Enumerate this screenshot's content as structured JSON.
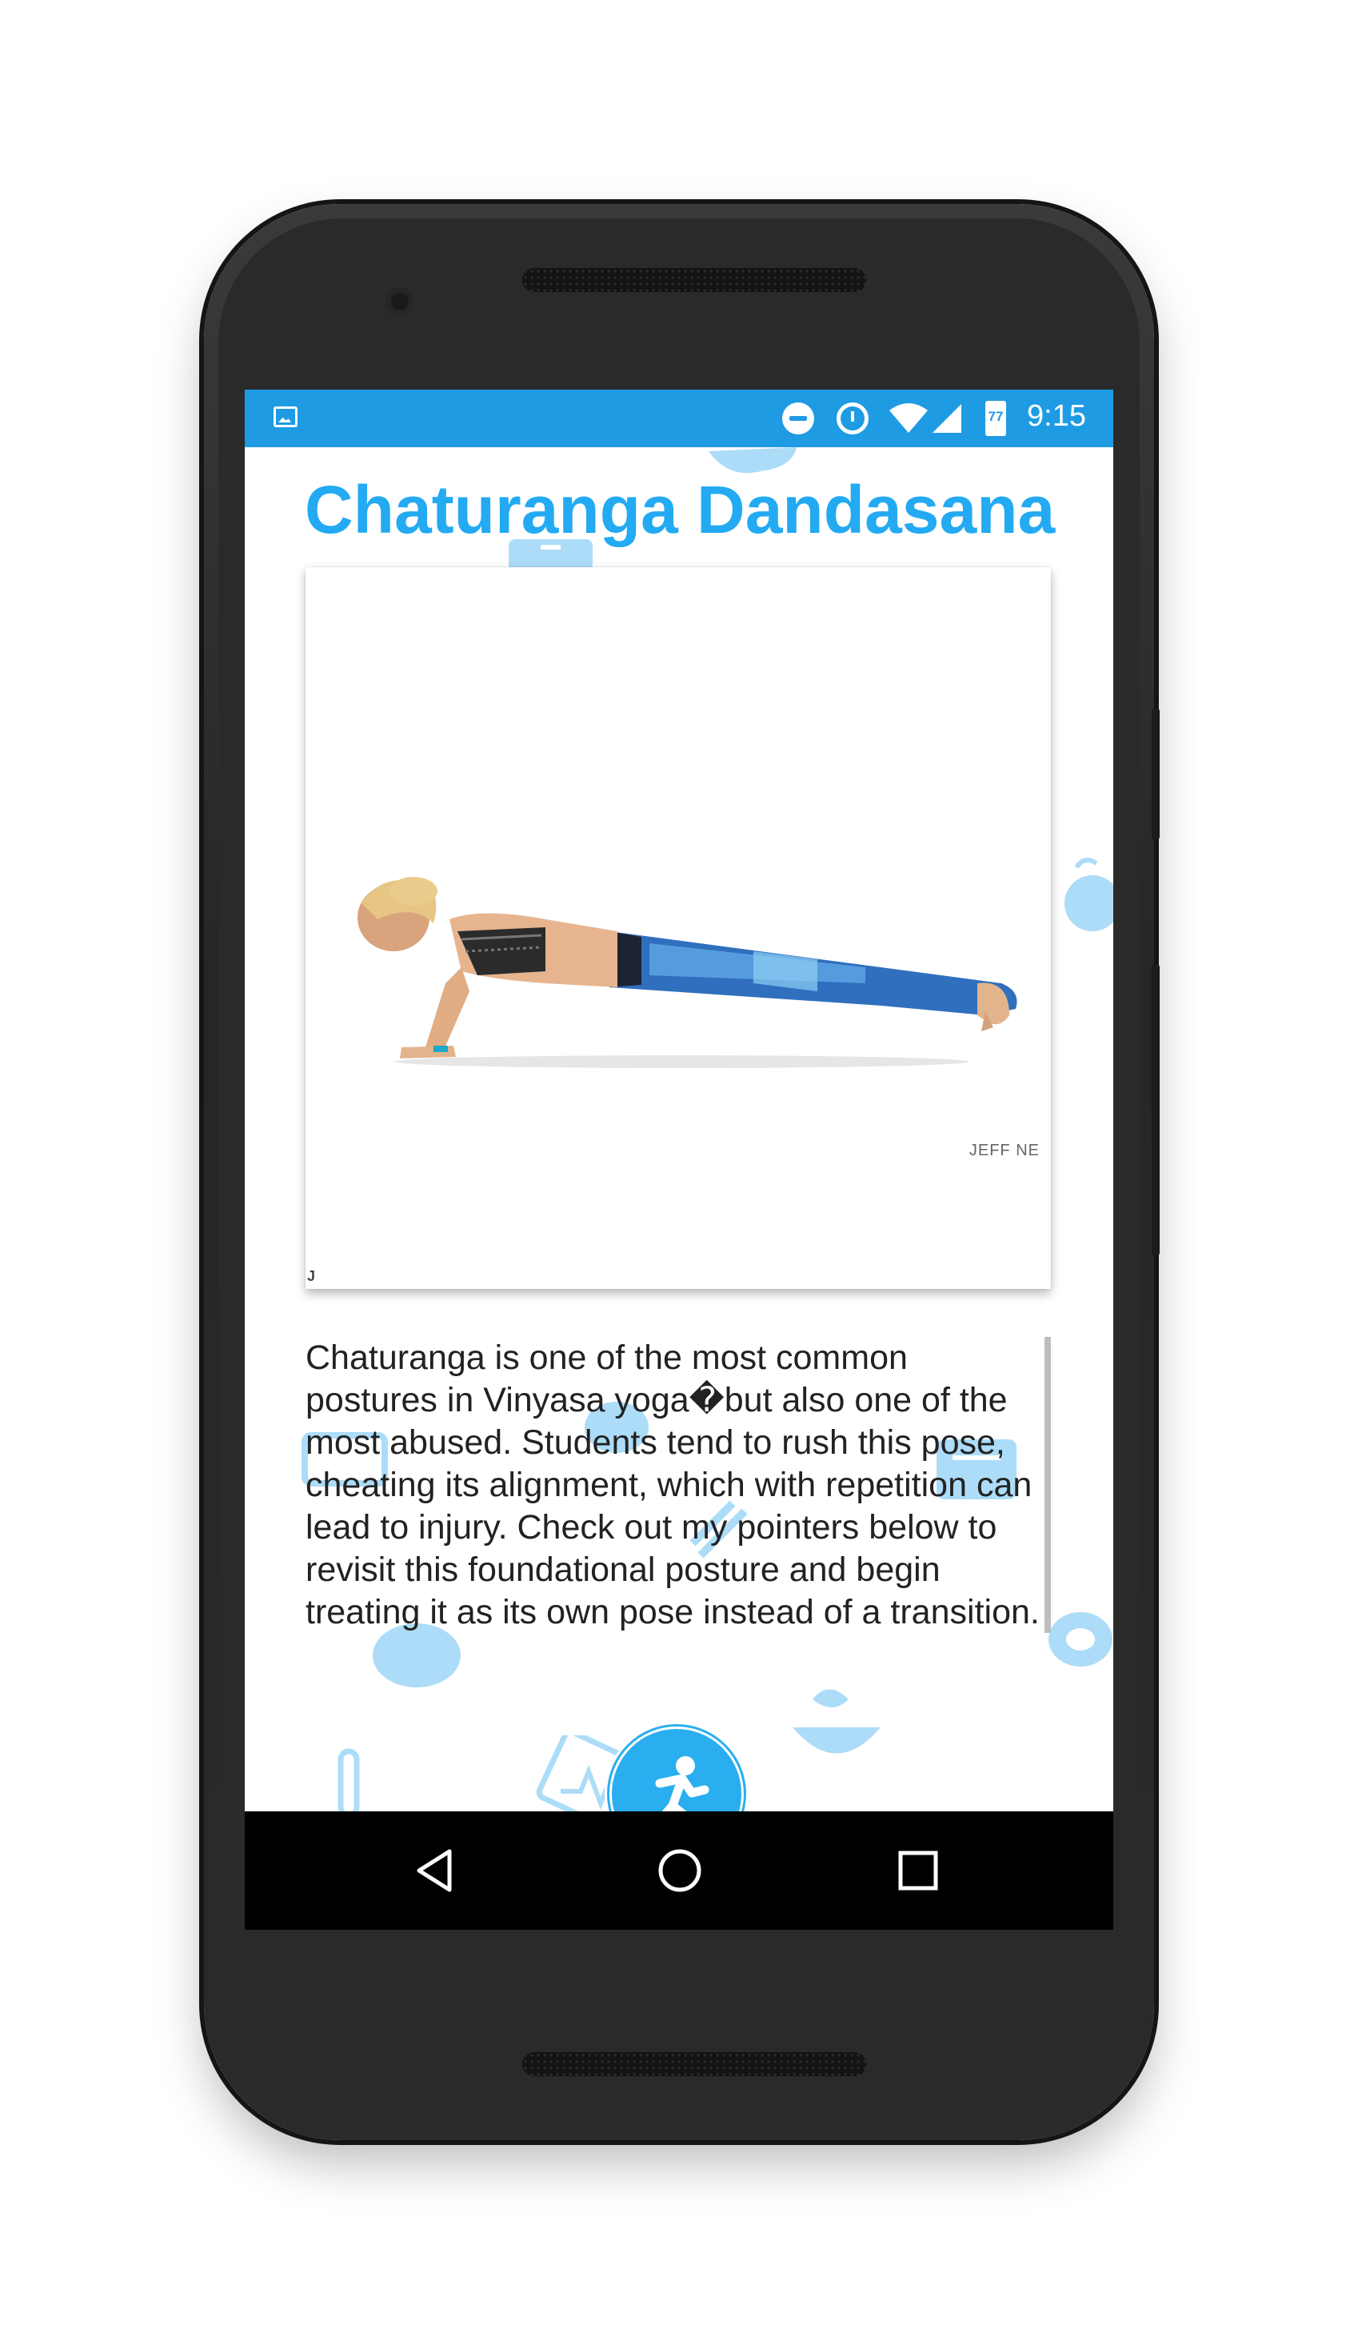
{
  "status_bar": {
    "time": "9:15",
    "battery_level_text": "77",
    "icons": [
      "gallery-notification-icon",
      "do-not-disturb-icon",
      "alarm-icon",
      "wifi-icon",
      "cell-signal-icon",
      "battery-icon"
    ]
  },
  "pose": {
    "title": "Chaturanga Dandasana",
    "image_alt": "Woman in Chaturanga Dandasana yoga pose",
    "photo_credit": "JEFF NE",
    "photo_corner_mark": "J",
    "description": "Chaturanga is one of the most common postures in Vinyasa yoga�but also one of the most abused. Students tend to rush this pose, cheating its alignment, which with repetition can lead to injury. Check out my pointers below to revisit this foundational posture and begin treating it as its own pose instead of a transition."
  },
  "fab": {
    "icon": "running-person-icon"
  },
  "nav_bar": {
    "buttons": [
      "back-icon",
      "home-icon",
      "recents-icon"
    ]
  },
  "colors": {
    "status_bar": "#1e9be3",
    "accent": "#23aaf2",
    "fab": "#2aaef0",
    "doodle": "#9ed6f7",
    "nav_bar": "#000000"
  }
}
